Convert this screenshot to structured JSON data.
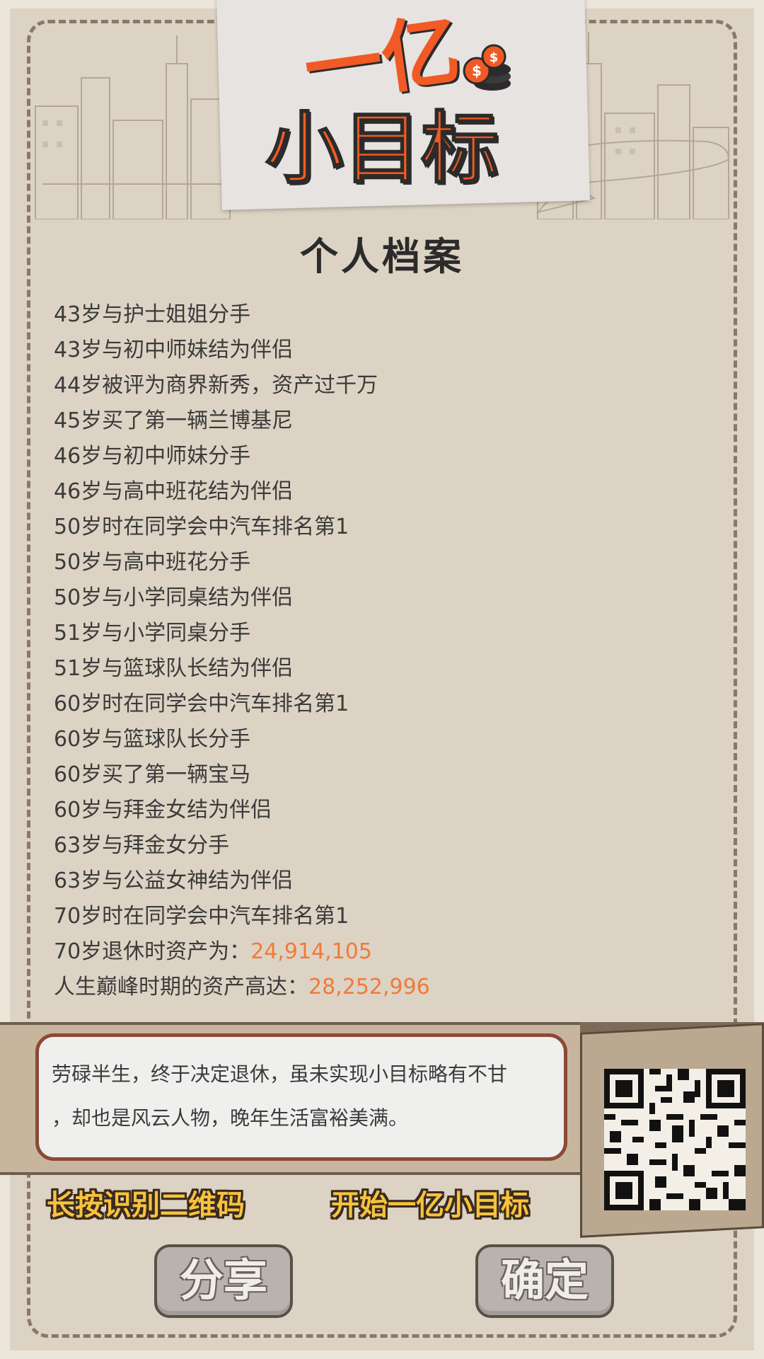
{
  "logo": {
    "line1": "一亿",
    "line2": "小目标"
  },
  "profile_title": "个人档案",
  "events": [
    {
      "text": "43岁与护士姐姐分手"
    },
    {
      "text": "43岁与初中师妹结为伴侣"
    },
    {
      "text": "44岁被评为商界新秀，资产过千万"
    },
    {
      "text": "45岁买了第一辆兰博基尼"
    },
    {
      "text": "46岁与初中师妹分手"
    },
    {
      "text": "46岁与高中班花结为伴侣"
    },
    {
      "text": "50岁时在同学会中汽车排名第1"
    },
    {
      "text": "50岁与高中班花分手"
    },
    {
      "text": "50岁与小学同桌结为伴侣"
    },
    {
      "text": "51岁与小学同桌分手"
    },
    {
      "text": "51岁与篮球队长结为伴侣"
    },
    {
      "text": "60岁时在同学会中汽车排名第1"
    },
    {
      "text": "60岁与篮球队长分手"
    },
    {
      "text": "60岁买了第一辆宝马"
    },
    {
      "text": "60岁与拜金女结为伴侣"
    },
    {
      "text": "63岁与拜金女分手"
    },
    {
      "text": "63岁与公益女神结为伴侣"
    },
    {
      "text": "70岁时在同学会中汽车排名第1"
    },
    {
      "text": "70岁退休时资产为：",
      "value": "24,914,105"
    },
    {
      "text": "人生巅峰时期的资产高达：",
      "value": "28,252,996"
    }
  ],
  "summary": {
    "line1": "劳碌半生，终于决定退休，虽未实现小目标略有不甘",
    "line2": "，却也是风云人物，晚年生活富裕美满。"
  },
  "cta": {
    "qr_hint": "长按识别二维码",
    "start": "开始一亿小目标"
  },
  "buttons": {
    "share": "分享",
    "confirm": "确定"
  },
  "colors": {
    "accent": "#f15a24",
    "value": "#f07a3a",
    "button": "#b9b3ad",
    "cta": "#f7c23c"
  }
}
